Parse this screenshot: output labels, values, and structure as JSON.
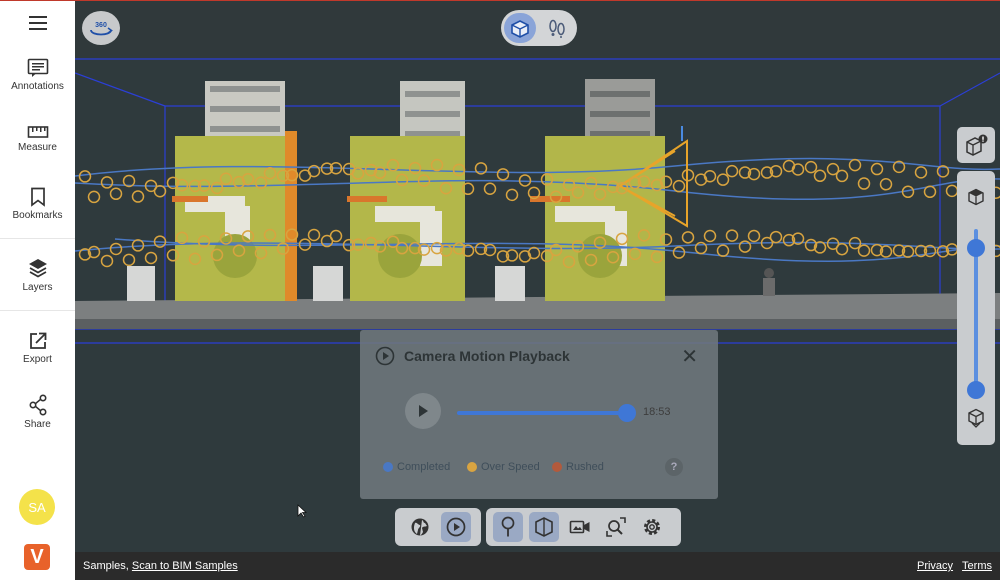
{
  "sidebar": {
    "menu_icon": "hamburger-icon",
    "items": [
      {
        "label": "Annotations",
        "icon": "annotations-icon"
      },
      {
        "label": "Measure",
        "icon": "ruler-icon"
      },
      {
        "label": "Bookmarks",
        "icon": "bookmark-icon"
      },
      {
        "label": "Layers",
        "icon": "layers-icon"
      },
      {
        "label": "Export",
        "icon": "export-icon"
      },
      {
        "label": "Share",
        "icon": "share-icon"
      }
    ],
    "avatar_initials": "SA",
    "logo_letter": "V"
  },
  "viewport": {
    "btn_360_label": "360",
    "view_toggle": [
      {
        "name": "3d-model-view",
        "icon": "box-icon",
        "active": true
      },
      {
        "name": "walk-view",
        "icon": "footsteps-icon",
        "active": false
      }
    ]
  },
  "playback": {
    "title": "Camera Motion Playback",
    "time": "18:53",
    "progress": 1.0,
    "legend": [
      {
        "label": "Completed",
        "color": "#4a78c4"
      },
      {
        "label": "Over Speed",
        "color": "#d9a441"
      },
      {
        "label": "Rushed",
        "color": "#b35a3c"
      }
    ],
    "help_label": "?"
  },
  "toolbar_left": [
    {
      "icon": "globe-icon",
      "active": false
    },
    {
      "icon": "play-circle-icon",
      "active": true
    }
  ],
  "toolbar_right": [
    {
      "icon": "pin-icon",
      "active": true
    },
    {
      "icon": "cube-outline-icon",
      "active": true
    },
    {
      "icon": "camera-video-icon",
      "active": false
    },
    {
      "icon": "zoom-extents-icon",
      "active": false
    },
    {
      "icon": "gear-icon",
      "active": false
    }
  ],
  "right_panel": {
    "top_icon": "model-alert-icon",
    "slider_top_icon": "cube-top-icon",
    "slider_bottom_icon": "cube-bottom-icon",
    "range_low": 0.0,
    "range_high": 1.0
  },
  "footer": {
    "prefix": "Samples,",
    "breadcrumb_link": "Scan to BIM Samples",
    "links": [
      "Privacy",
      "Terms"
    ]
  }
}
